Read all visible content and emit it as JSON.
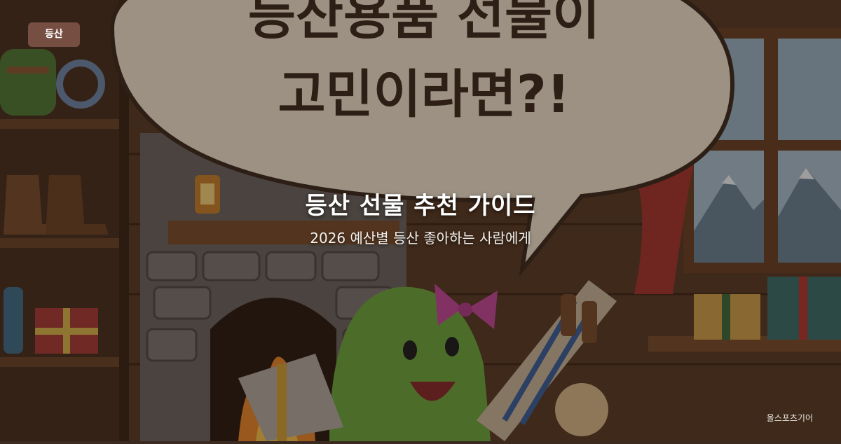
{
  "category_label": "등산",
  "title": "등산 선물 추천 가이드",
  "subtitle": "2026 예산별 등산 좋아하는 사람에게",
  "brand": "올스포츠기어",
  "illustration": {
    "speech_bubble_lines": [
      "등산용품 선물이",
      "고민이라면?!"
    ]
  },
  "colors": {
    "pill_bg": "#7c5446",
    "bubble_text": "#3d2b1e"
  }
}
